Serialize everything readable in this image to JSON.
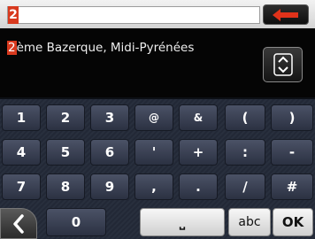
{
  "search": {
    "query": "2"
  },
  "result": {
    "highlight": "2",
    "rest": "ème Bazerque, Midi-Pyrénées"
  },
  "keys": {
    "row1": [
      "1",
      "2",
      "3",
      "@",
      "&",
      "(",
      ")"
    ],
    "row2": [
      "4",
      "5",
      "6",
      "'",
      "+",
      ":",
      "-"
    ],
    "row3": [
      "7",
      "8",
      "9",
      ",",
      ".",
      "/",
      "#"
    ],
    "zero": "0",
    "space": "⎵",
    "abc": "abc",
    "ok": "OK"
  },
  "icons": {
    "backspace": "left-arrow-icon",
    "scroll": "up-down-chevron-icon",
    "back": "chevron-left-icon"
  },
  "colors": {
    "accent": "#d8391e",
    "key_dark": "#3a4154",
    "key_light": "#e6e6e6"
  }
}
